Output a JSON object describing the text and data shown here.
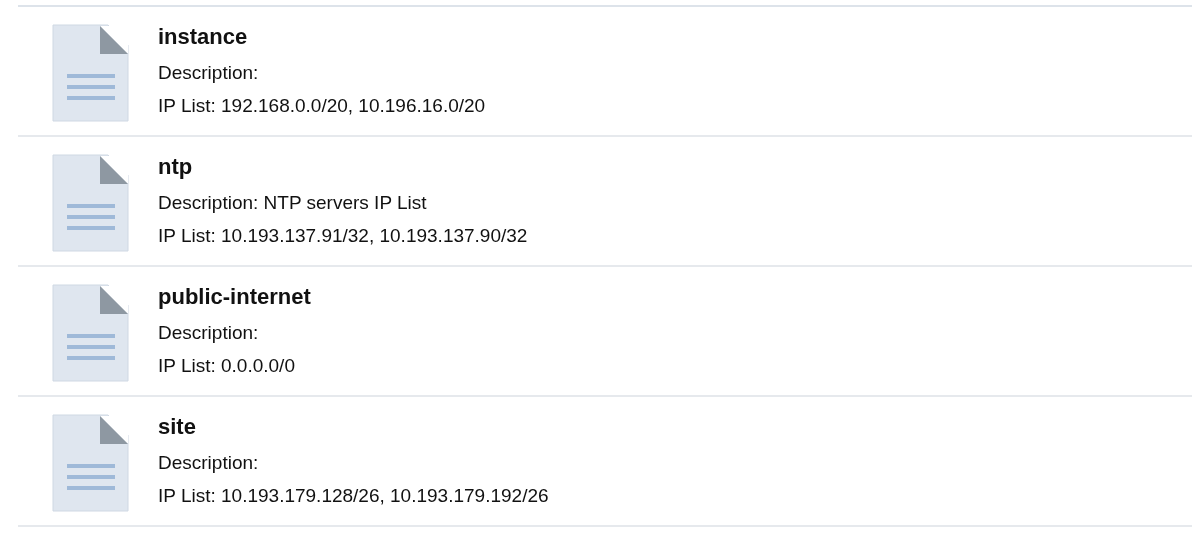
{
  "items": [
    {
      "title": "instance",
      "description": "Description:",
      "ip_list": "IP List: 192.168.0.0/20, 10.196.16.0/20"
    },
    {
      "title": "ntp",
      "description": "Description: NTP servers IP List",
      "ip_list": "IP List: 10.193.137.91/32, 10.193.137.90/32"
    },
    {
      "title": "public-internet",
      "description": "Description:",
      "ip_list": "IP List: 0.0.0.0/0"
    },
    {
      "title": "site",
      "description": "Description:",
      "ip_list": "IP List: 10.193.179.128/26, 10.193.179.192/26"
    }
  ]
}
